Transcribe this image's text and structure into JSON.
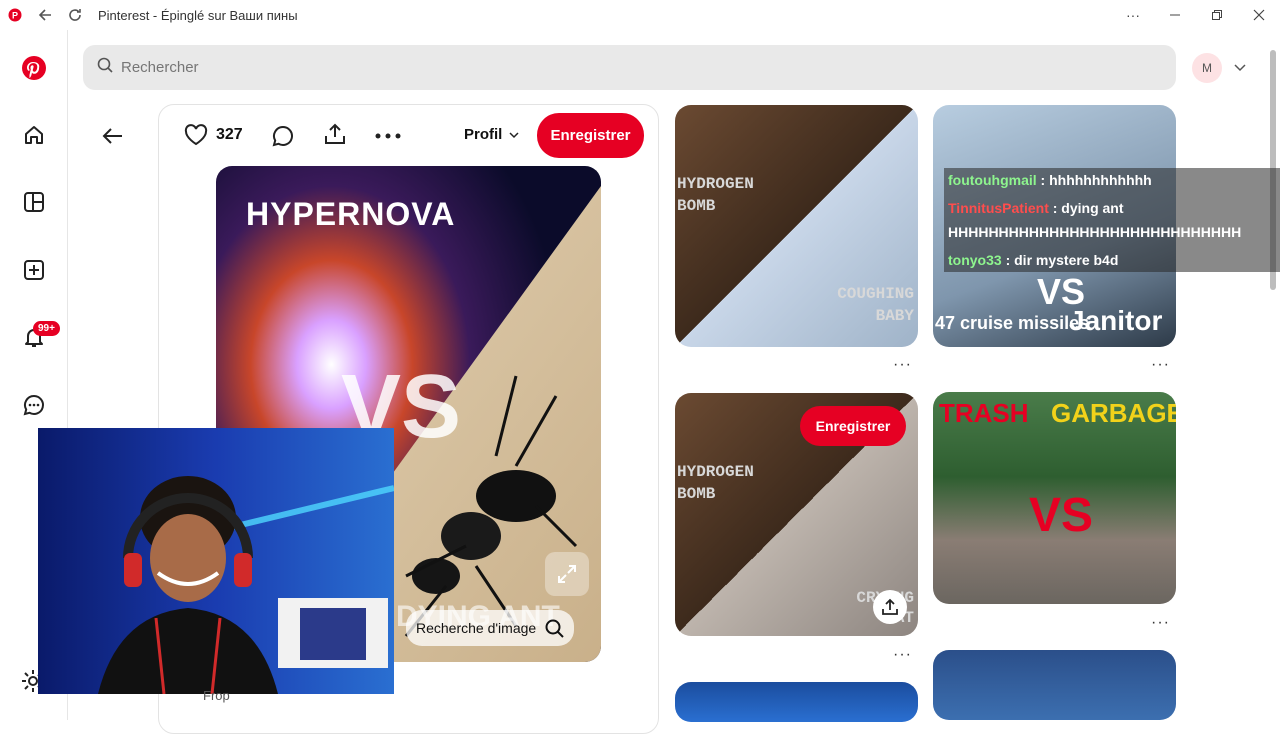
{
  "window": {
    "title": "Pinterest - Épinglé sur Ваши пины",
    "controls": [
      "more-icon",
      "minimize-icon",
      "restore-icon",
      "close-icon"
    ]
  },
  "search": {
    "placeholder": "Rechercher"
  },
  "user": {
    "avatar_initial": "M"
  },
  "sidebar": {
    "items": [
      "pinterest-logo",
      "home-icon",
      "boards-icon",
      "create-icon",
      "notifications-icon",
      "messages-icon",
      "settings-icon"
    ],
    "notification_badge": "99+"
  },
  "pin": {
    "like_count": "327",
    "profile_label": "Profil",
    "save_label": "Enregistrer",
    "image_title": "HYPERNOVA",
    "image_vs": "VS",
    "image_bottom_text": "DYING ANT",
    "image_search_label": "Recherche d'image",
    "author_fragment": "Frop"
  },
  "grid": {
    "pins": [
      {
        "text_top": "HYDROGEN BOMB",
        "text_bottom": "COUGHING BABY"
      },
      {
        "text_left": "47 cruise missiles",
        "text_right": "Janitor",
        "vs": "VS"
      },
      {
        "text_top": "HYDROGEN BOMB",
        "text_bottom": "CRYING CAT",
        "save_label": "Enregistrer"
      },
      {
        "text_left": "TRASH",
        "text_right": "GARBAGE",
        "vs": "VS"
      }
    ],
    "more_label": "···"
  },
  "chat": [
    {
      "user": "foutouhgmail",
      "message": " : hhhhhhhhhhhh",
      "color": "#8ef58e"
    },
    {
      "user": "TinnitusPatient",
      "message": " : dying ant",
      "color": "#ff4d4d"
    },
    {
      "user": "",
      "message": "HHHHHHHHHHHHHHHHHHHHHHHHHHHHH",
      "color": "#ffffff"
    },
    {
      "user": "tonyo33",
      "message": " : dir mystere b4d",
      "color": "#8ef58e"
    }
  ],
  "colors": {
    "accent": "#e60023",
    "logo": "#e60023"
  }
}
